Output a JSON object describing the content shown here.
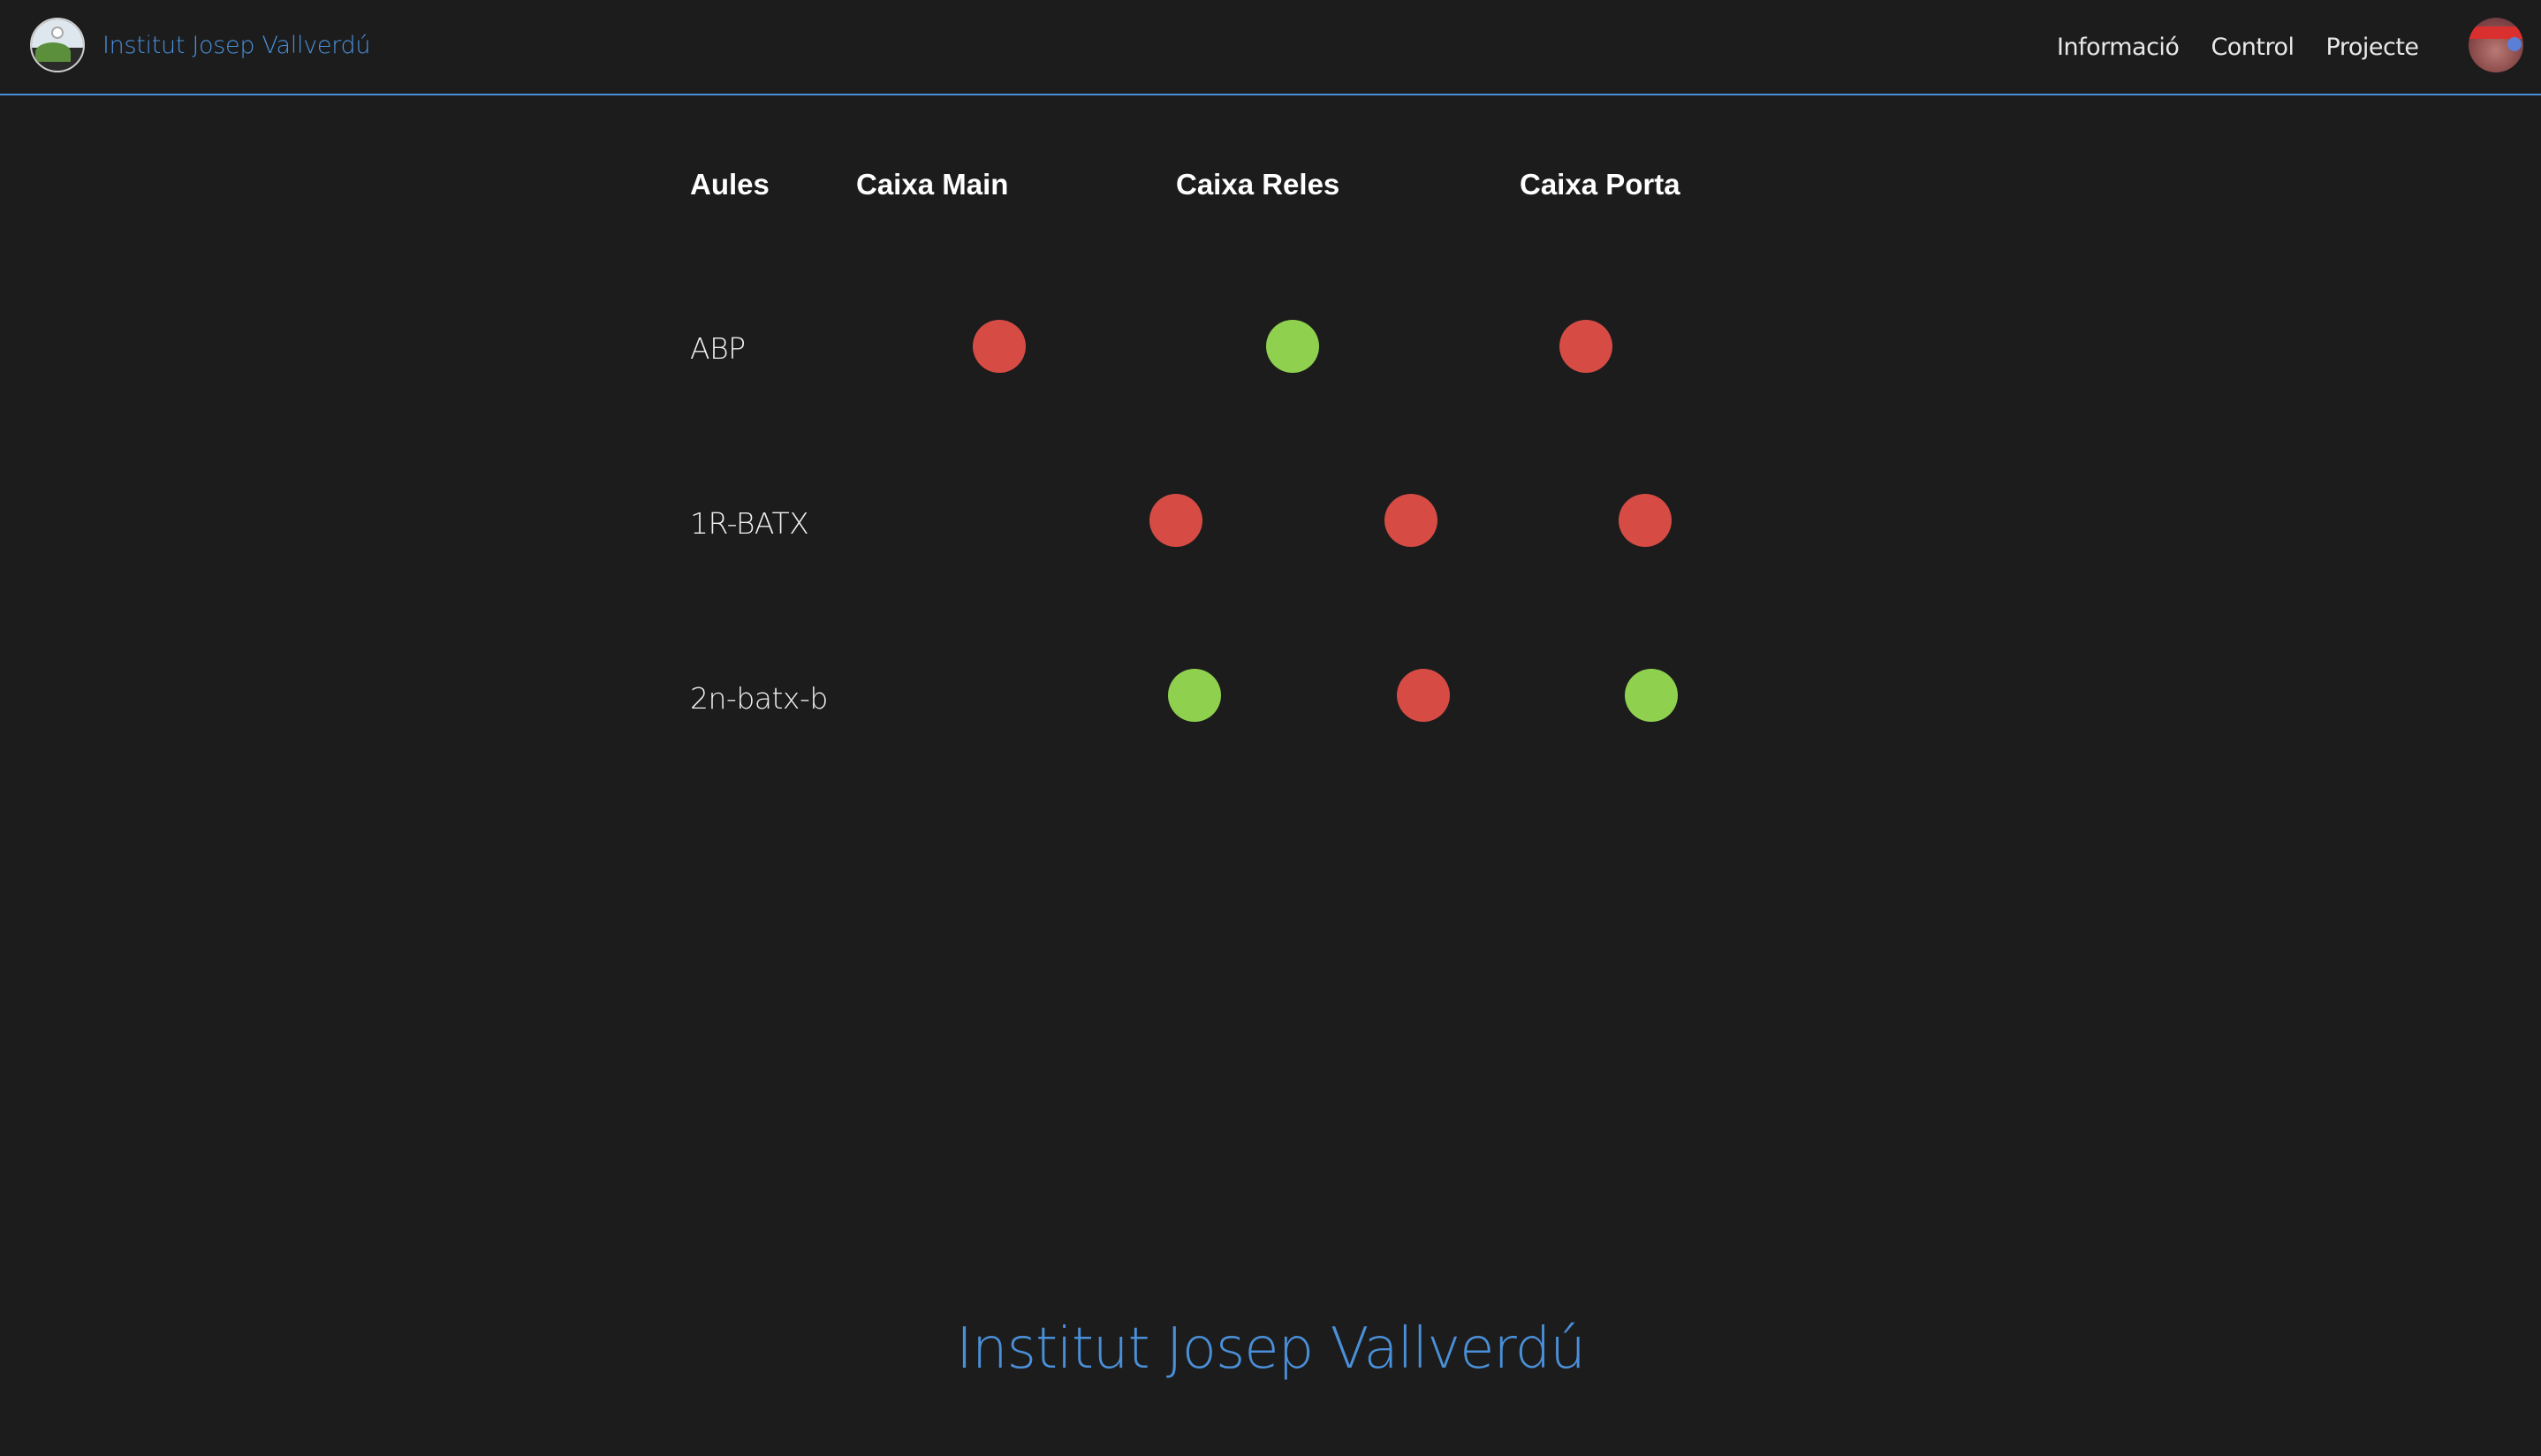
{
  "header": {
    "brand": "Institut Josep Vallverdú",
    "nav": [
      "Informació",
      "Control",
      "Projecte"
    ]
  },
  "table": {
    "headers": {
      "aules": "Aules",
      "main": "Caixa Main",
      "reles": "Caixa Reles",
      "porta": "Caixa Porta"
    },
    "rows": [
      {
        "name": "ABP",
        "main": "off",
        "reles": "on",
        "porta": "off"
      },
      {
        "name": "1R-BATX",
        "main": "off",
        "reles": "off",
        "porta": "off"
      },
      {
        "name": "2n-batx-b",
        "main": "on",
        "reles": "off",
        "porta": "on"
      }
    ]
  },
  "status_colors": {
    "on": "#8fd14f",
    "off": "#d64c45"
  },
  "footer": {
    "title": "Institut Josep Vallverdú"
  }
}
